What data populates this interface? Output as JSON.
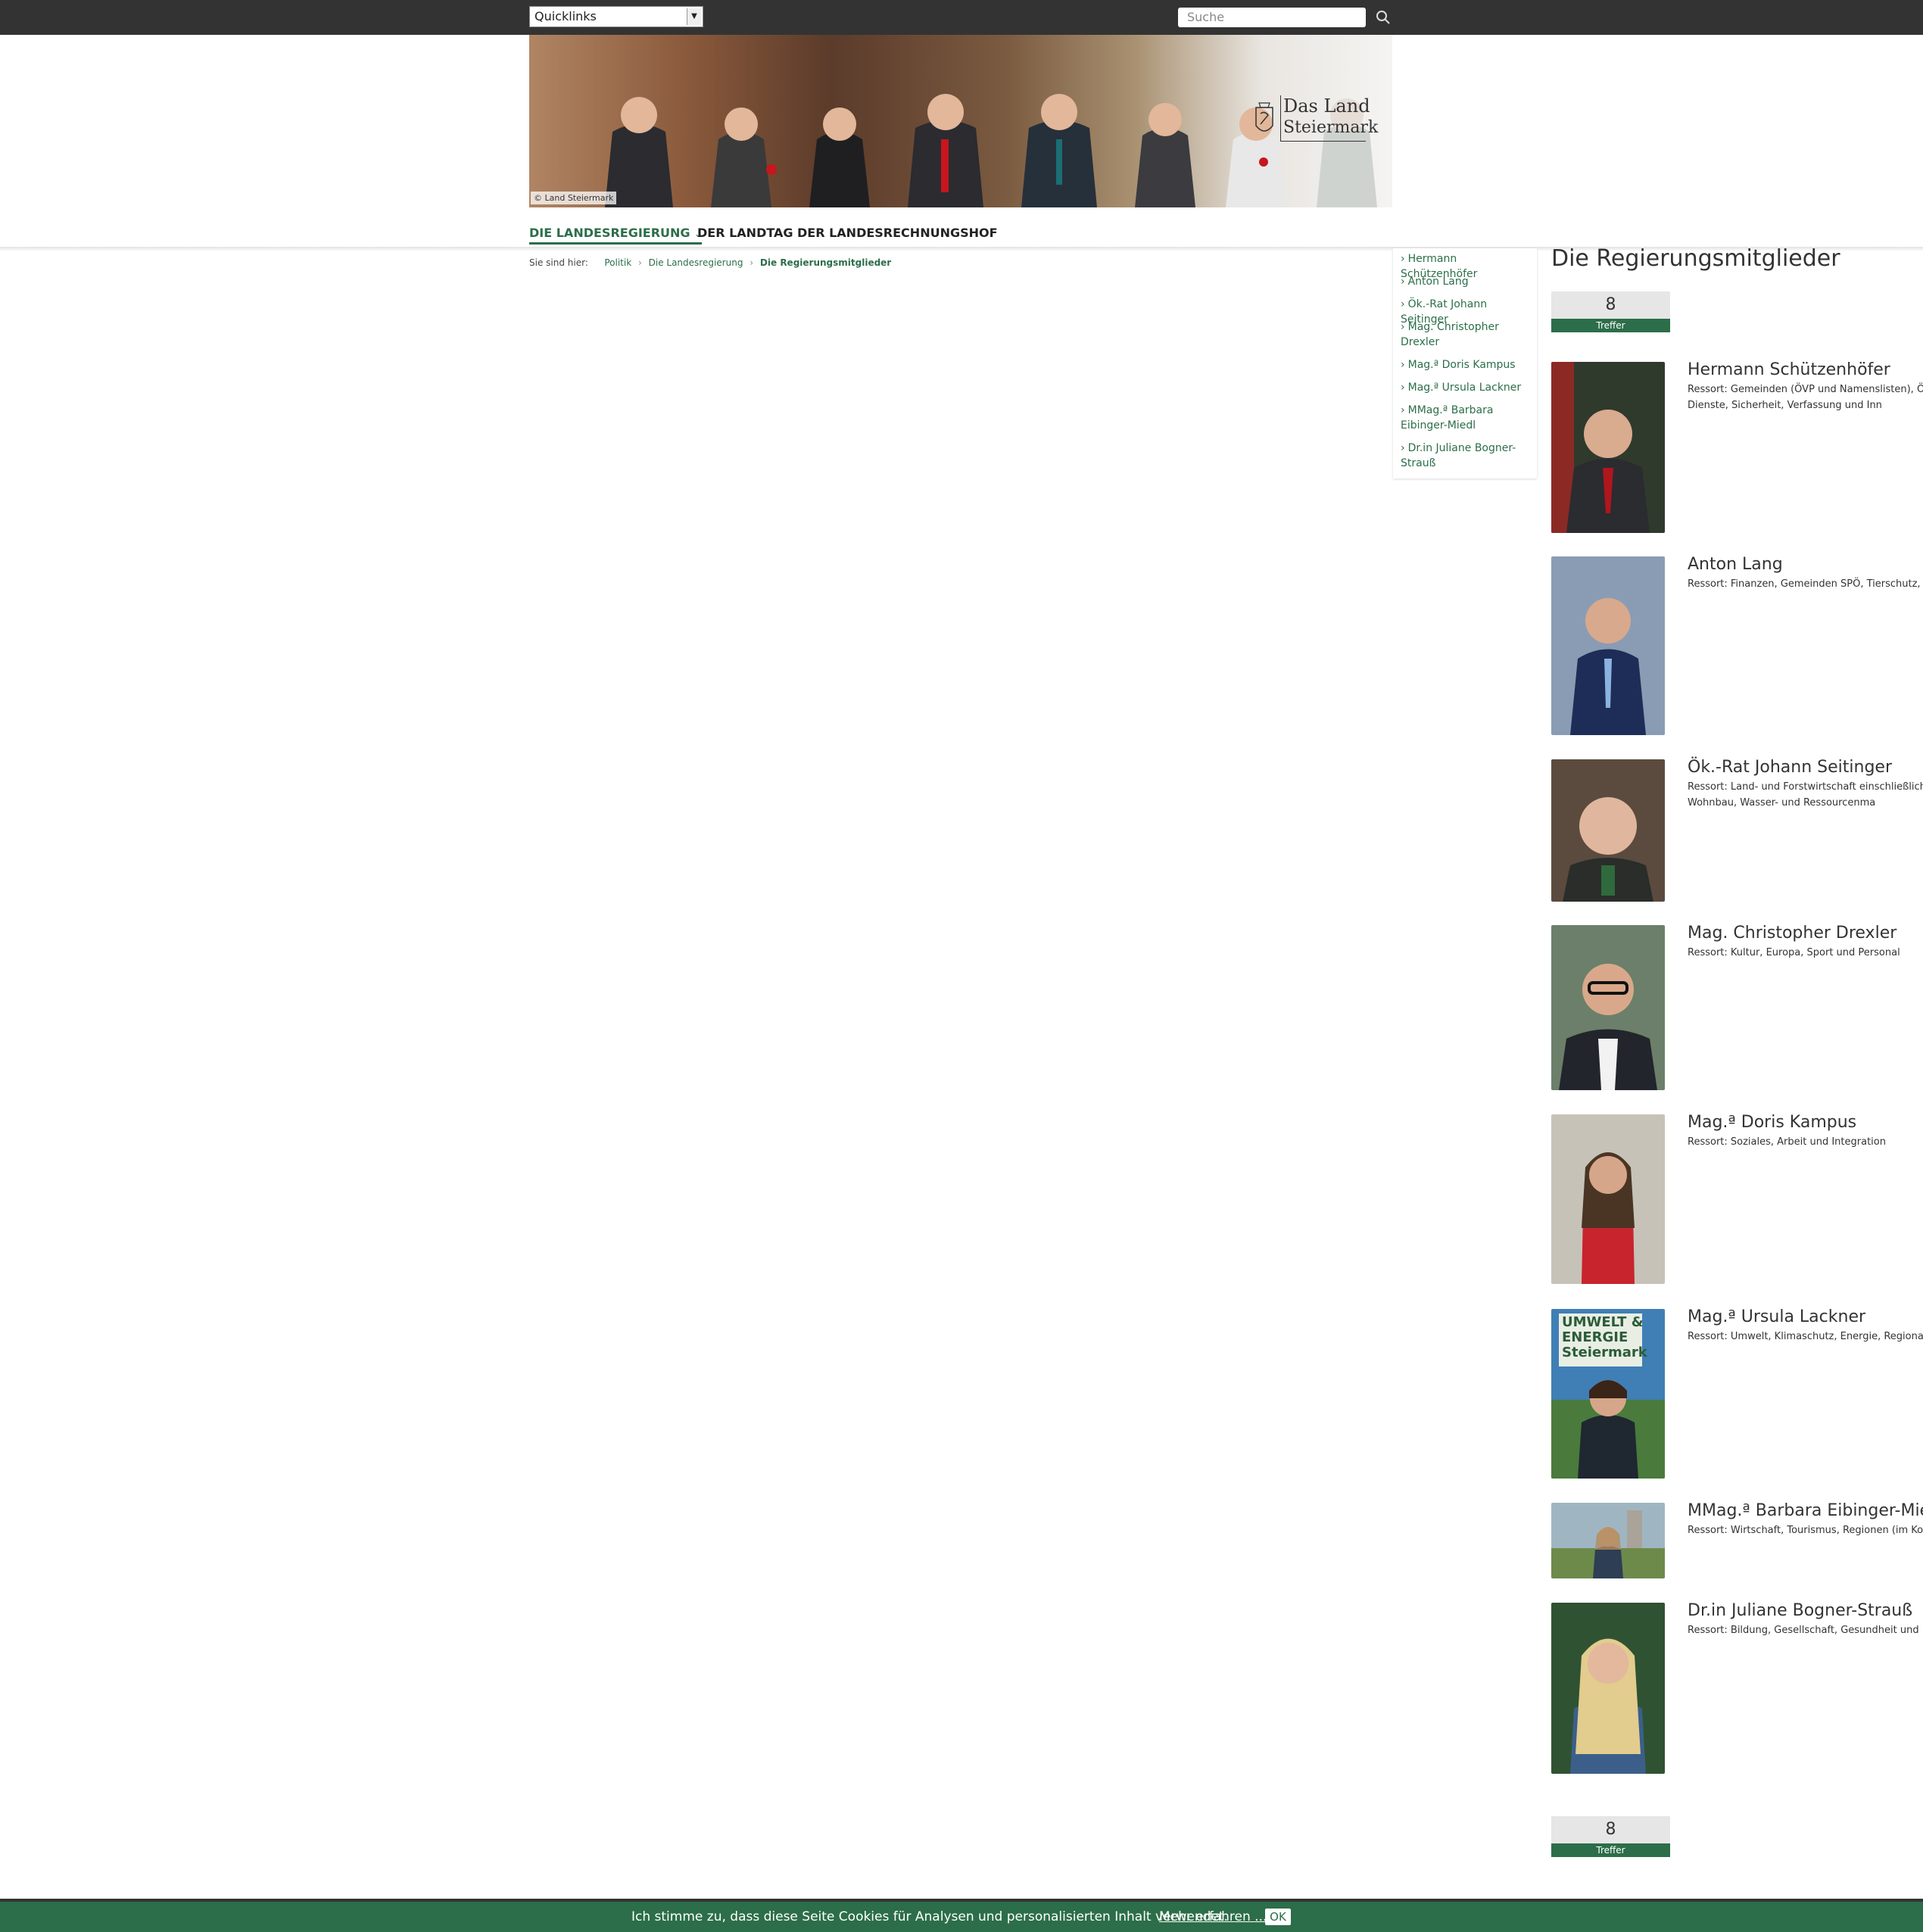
{
  "header": {
    "quicklinks_label": "Quicklinks",
    "search_placeholder": "Suche"
  },
  "hero": {
    "caption": "© Land Steiermark",
    "logo_line1": "Das Land",
    "logo_line2": "Steiermark"
  },
  "nav": {
    "items": [
      "DIE LANDESREGIERUNG",
      "DER LANDTAG",
      "DER LANDESRECHNUNGSHOF"
    ],
    "active": "DIE LANDESREGIERUNG"
  },
  "breadcrumb": {
    "prefix": "Sie sind hier:",
    "items": [
      "Politik",
      "Die Landesregierung",
      "Die Regierungsmitglieder"
    ]
  },
  "sidenav": {
    "items": [
      "Hermann Schützenhöfer",
      "Anton Lang",
      "Ök.-Rat Johann Seitinger",
      "Mag. Christopher Drexler",
      "Mag.ª Doris Kampus",
      "Mag.ª Ursula Lackner",
      "MMag.ª Barbara Eibinger-Miedl",
      "Dr.in Juliane Bogner-Strauß"
    ]
  },
  "main": {
    "title": "Die Regierungsmitglieder",
    "count": "8",
    "count_label": "Treffer",
    "members": [
      {
        "name": "Hermann Schützenhöfer",
        "resort": "Ressort: Gemeinden (ÖVP und Namenslisten), Ö Zentrale Dienste, Sicherheit, Verfassung und Inn"
      },
      {
        "name": "Anton Lang",
        "resort": "Ressort: Finanzen, Gemeinden SPÖ, Tierschutz, Koreferat)"
      },
      {
        "name": "Ök.-Rat Johann Seitinger",
        "resort": "Ressort: Land- und Forstwirtschaft einschließlich Schulen, Wohnbau, Wasser- und Ressourcenma"
      },
      {
        "name": "Mag. Christopher Drexler",
        "resort": "Ressort: Kultur, Europa, Sport und Personal"
      },
      {
        "name": "Mag.ª Doris Kampus",
        "resort": "Ressort: Soziales, Arbeit und Integration"
      },
      {
        "name": "Mag.ª Ursula Lackner",
        "resort": "Ressort: Umwelt, Klimaschutz, Energie, Regional Raumordnung"
      },
      {
        "name": "MMag.ª Barbara Eibinger-Miedl",
        "resort": "Ressort: Wirtschaft, Tourismus, Regionen (im Ko Forschung"
      },
      {
        "name": "Dr.in Juliane Bogner-Strauß",
        "resort": "Ressort: Bildung, Gesellschaft, Gesundheit und P"
      }
    ],
    "photo_label_lackner": "UMWELT & ENERGIE Steiermark"
  },
  "cookie": {
    "text": "Ich stimme zu, dass diese Seite Cookies für Analysen und personalisierten Inhalt verwendet.",
    "link": "Mehr erfahren ...",
    "ok": "OK"
  },
  "colors": {
    "accent": "#2c6e49",
    "topbar": "#333333"
  }
}
